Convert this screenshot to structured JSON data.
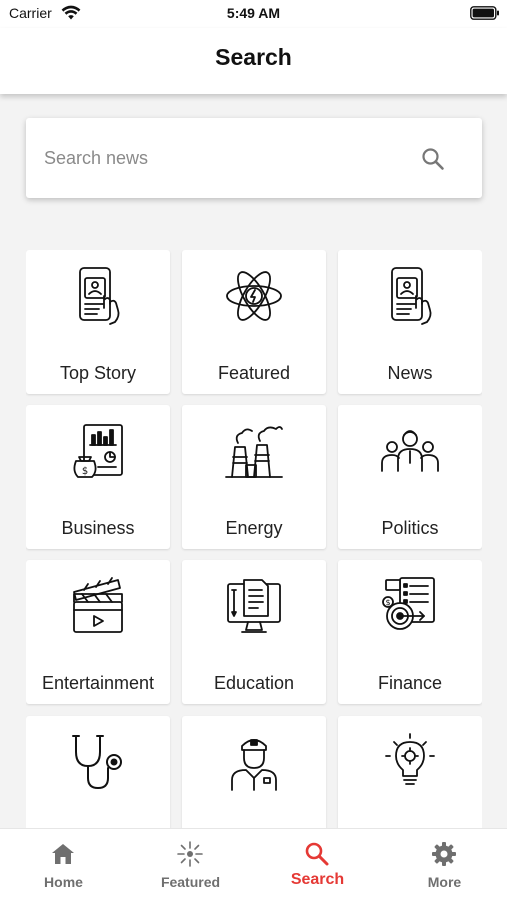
{
  "status_bar": {
    "carrier": "Carrier",
    "time": "5:49 AM"
  },
  "nav": {
    "title": "Search"
  },
  "search": {
    "placeholder": "Search news",
    "value": ""
  },
  "categories": [
    {
      "label": "Top Story",
      "icon": "phone-touch-icon"
    },
    {
      "label": "Featured",
      "icon": "atom-icon"
    },
    {
      "label": "News",
      "icon": "phone-touch-icon"
    },
    {
      "label": "Business",
      "icon": "business-report-icon"
    },
    {
      "label": "Energy",
      "icon": "power-plant-icon"
    },
    {
      "label": "Politics",
      "icon": "people-group-icon"
    },
    {
      "label": "Entertainment",
      "icon": "clapperboard-icon"
    },
    {
      "label": "Education",
      "icon": "computer-document-icon"
    },
    {
      "label": "Finance",
      "icon": "finance-target-icon"
    },
    {
      "label": "",
      "icon": "stethoscope-icon"
    },
    {
      "label": "",
      "icon": "officer-icon"
    },
    {
      "label": "",
      "icon": "lightbulb-gear-icon"
    }
  ],
  "tabs": [
    {
      "label": "Home",
      "icon": "home-icon",
      "active": false
    },
    {
      "label": "Featured",
      "icon": "sparkle-icon",
      "active": false
    },
    {
      "label": "Search",
      "icon": "search-icon",
      "active": true
    },
    {
      "label": "More",
      "icon": "gear-icon",
      "active": false
    }
  ],
  "colors": {
    "accent": "#e53935",
    "inactive_tab": "#6f6f6f",
    "background": "#f3f3f3"
  }
}
